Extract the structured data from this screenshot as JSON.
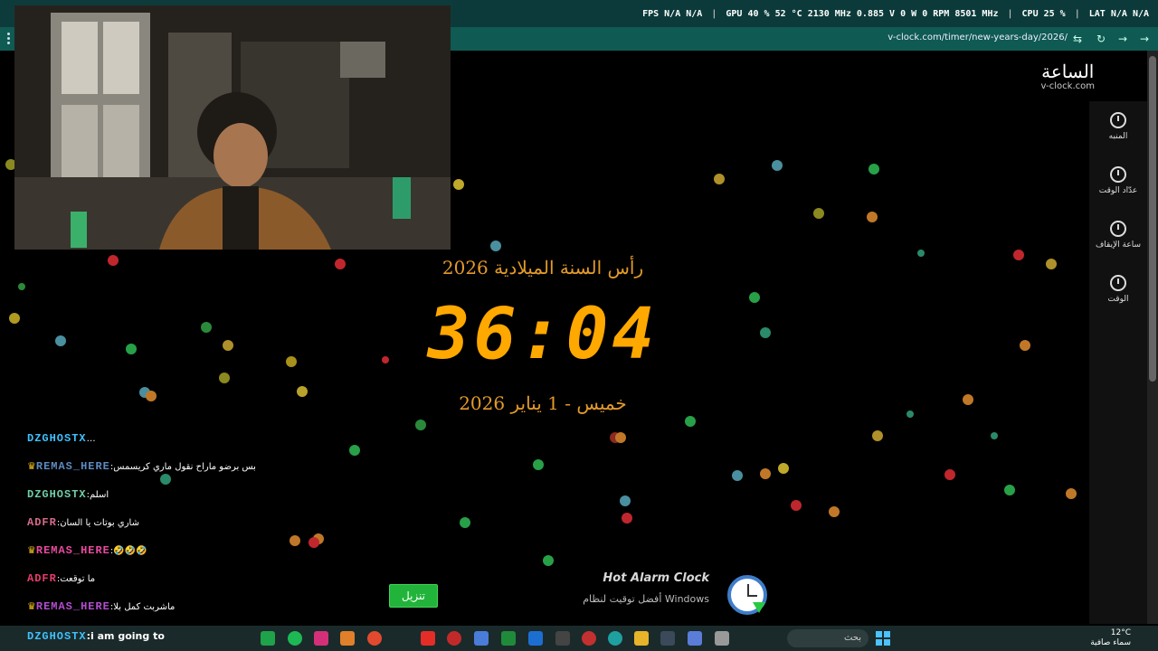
{
  "overlay": {
    "fps_label": "FPS",
    "fps_value": "N/A",
    "fps_value2": "N/A",
    "gpu_label": "GPU",
    "gpu_load": "40 %",
    "gpu_temp": "52 °C",
    "gpu_clock": "2130 MHz",
    "gpu_volt": "0.885 V",
    "gpu_power": "0 W",
    "gpu_fan": "0 RPM",
    "gpu_mem": "8501 MHz",
    "cpu_label": "CPU",
    "cpu_load": "25 %",
    "lat_label": "LAT",
    "lat_value": "N/A",
    "lat_value2": "N/A"
  },
  "browser": {
    "url": "v-clock.com/timer/new-years-day/2026/"
  },
  "site": {
    "brand_ar": "الساعة",
    "brand_en": "v-clock.com",
    "nav": [
      {
        "label": "المنبه",
        "icon": "alarm-icon"
      },
      {
        "label": "عدّاد الوقت",
        "icon": "timer-icon"
      },
      {
        "label": "ساعة الإيقاف",
        "icon": "stopwatch-icon"
      },
      {
        "label": "الوقت",
        "icon": "clock-icon"
      }
    ],
    "event_title": "رأس السنة الميلادية 2026",
    "countdown": "36:04",
    "event_date": "خميس - 1 يناير 2026",
    "download_button": "تنزيل",
    "ad_brand": "Hot Alarm Clock",
    "ad_tagline": "أفضل توقيت لنظام Windows"
  },
  "chat": {
    "messages": [
      {
        "nick": "DZGHOSTX",
        "text": "…",
        "color": "#3fc2ff",
        "crown": false
      },
      {
        "nick": "REMAS_HERE",
        "text": "بس برضو ماراح نقول ماري كريسمس",
        "color": "#5d8bc2",
        "crown": true
      },
      {
        "nick": "DZGHOSTX",
        "text": "اسلم",
        "color": "#6fd0a8",
        "crown": false
      },
      {
        "nick": "ADFR",
        "text": "شاري بوتات يا السان",
        "color": "#d56b8b",
        "crown": false
      },
      {
        "nick": "REMAS_HERE",
        "text": "🤣🤣🤣",
        "color": "#ea4aa0",
        "crown": true
      },
      {
        "nick": "ADFR",
        "text": "ما توقعت",
        "color": "#e63e6b",
        "crown": false
      },
      {
        "nick": "REMAS_HERE",
        "text": "ماشربت كمل بلا",
        "color": "#b44ed0",
        "crown": true
      }
    ]
  },
  "taskbar": {
    "caption_nick": "DZGHOSTX",
    "caption_text": "i am going to",
    "search_placeholder": "بحث",
    "temp": "12°C",
    "weather": "سماء صافية"
  }
}
